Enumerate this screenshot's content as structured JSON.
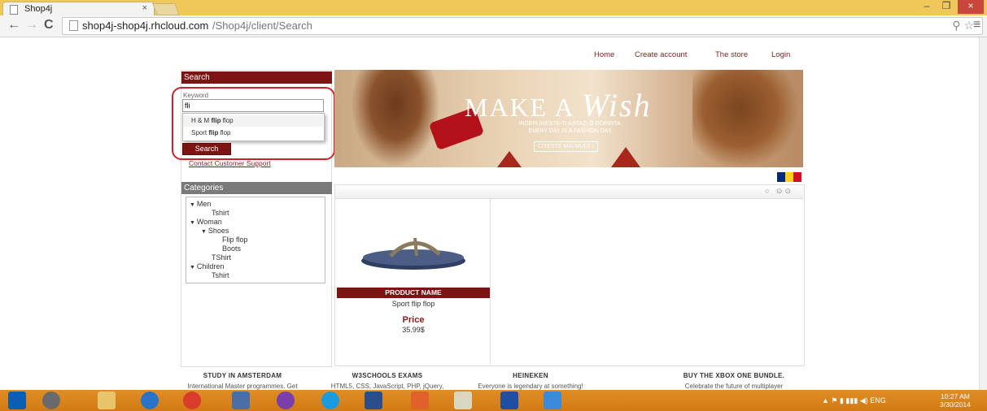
{
  "browser": {
    "tab_title": "Shop4j",
    "tab_close": "×",
    "url_host": "shop4j-shop4j.rhcloud.com",
    "url_path": "/Shop4j/client/Search",
    "omni_icons": "⚲☆",
    "menu_icon": "≡",
    "window_controls": {
      "minimize": "–",
      "maximize": "❐",
      "close": "×"
    }
  },
  "topnav": [
    "Home",
    "Create account",
    "The store",
    "Login"
  ],
  "search": {
    "heading": "Search",
    "keyword_label": "Keyword",
    "keyword_value": "fli",
    "suggestions": [
      {
        "prefix": "H & M ",
        "match": "flip",
        "suffix": " flop"
      },
      {
        "prefix": "Sport ",
        "match": "flip",
        "suffix": " flop"
      }
    ],
    "button_label": "Search",
    "support_link": "Contact Customer Support"
  },
  "categories": {
    "heading": "Categories",
    "items": [
      {
        "label": "Men",
        "expanded": true,
        "level": 0
      },
      {
        "label": "Tshirt",
        "level": 1
      },
      {
        "label": "Woman",
        "expanded": true,
        "level": 0
      },
      {
        "label": "Shoes",
        "expanded": true,
        "level": 1
      },
      {
        "label": "Flip flop",
        "level": 2
      },
      {
        "label": "Boots",
        "level": 2
      },
      {
        "label": "TShirt",
        "level": 1
      },
      {
        "label": "Children",
        "expanded": true,
        "level": 0
      },
      {
        "label": "Tshirt",
        "level": 1
      }
    ]
  },
  "banner": {
    "title_prefix": "MAKE A",
    "title_script": "Wish",
    "subtitle_line1": "INDEPLINESTE-TI ASTAZI O DORINTA.",
    "subtitle_line2": "EVERY DAY IS A FASHION DAY.",
    "button": "CITESTE MAI MULT ›"
  },
  "flag_colors": [
    "#002b7f",
    "#fcd116",
    "#ce1126"
  ],
  "pager_icons": "○ ⊙⊙",
  "product": {
    "header": "PRODUCT NAME",
    "name": "Sport flip flop",
    "price_label": "Price",
    "price_value": "35.99$"
  },
  "ads": [
    {
      "title": "STUDY IN AMSTERDAM",
      "body": "International Master programmes. Get"
    },
    {
      "title": "W3SCHOOLS EXAMS",
      "body": "HTML5, CSS, JavaScript, PHP, jQuery,"
    },
    {
      "title": "HEINEKEN",
      "body": "Everyone is legendary at something!"
    },
    {
      "title": "BUY THE XBOX ONE BUNDLE.",
      "body": "Celebrate the future of multiplayer"
    }
  ],
  "taskbar": {
    "tray_lang": "ENG",
    "clock_time": "10:27 AM",
    "clock_date": "3/30/2014"
  },
  "colors": {
    "brand": "#7d1414",
    "accent": "#8c1a1a",
    "highlight": "#d0202a",
    "taskbar": "#d27a14"
  }
}
